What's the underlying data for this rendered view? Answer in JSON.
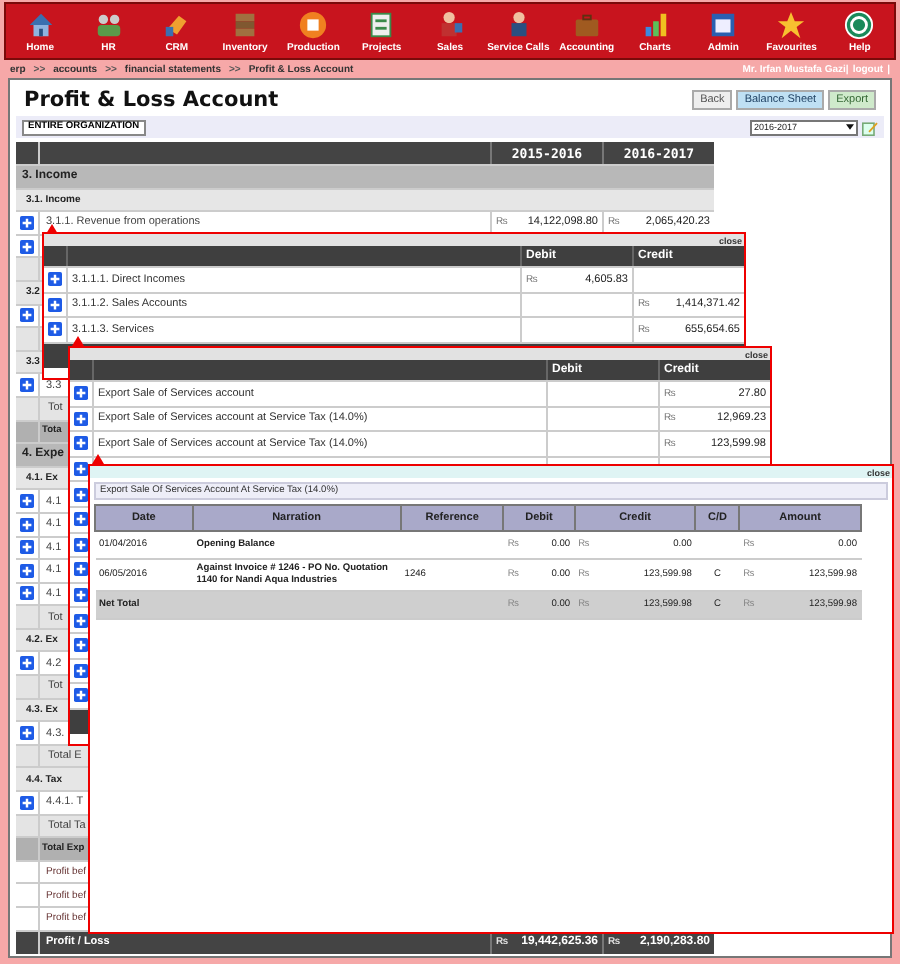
{
  "nav": [
    "Home",
    "HR",
    "CRM",
    "Inventory",
    "Production",
    "Projects",
    "Sales",
    "Service Calls",
    "Accounting",
    "Charts",
    "Admin",
    "Favourites",
    "Help"
  ],
  "breadcrumb": {
    "items": [
      "erp",
      "accounts",
      "financial statements",
      "Profit & Loss Account"
    ],
    "separator": ">>"
  },
  "user": {
    "name": "Mr. Irfan Mustafa Gazi|",
    "logout": "logout",
    "end": "|"
  },
  "page_title": "Profit & Loss Account",
  "actions": [
    "Back",
    "Balance Sheet",
    "Export"
  ],
  "scope_button": "ENTIRE ORGANIZATION",
  "year_select": {
    "value": "2016-2017"
  },
  "table": {
    "columns": [
      "2015-2016",
      "2016-2017"
    ],
    "rows": [
      {
        "kind": "section",
        "name": "3. Income"
      },
      {
        "kind": "subsection",
        "name": "3.1. Income"
      },
      {
        "kind": "item",
        "name": "3.1.1. Revenue from operations",
        "values": [
          [
            "₨",
            "14,122,098.80"
          ],
          [
            "₨",
            "2,065,420.23"
          ]
        ]
      },
      {
        "kind": "item"
      },
      {
        "kind": "total"
      },
      {
        "kind": "subsection",
        "name": "3.2"
      },
      {
        "kind": "item"
      },
      {
        "kind": "total"
      },
      {
        "kind": "subsection",
        "name": "3.3"
      },
      {
        "kind": "item",
        "name": "3.3"
      },
      {
        "kind": "total",
        "name": "Tot"
      },
      {
        "kind": "grandtotal",
        "name": "Tota"
      },
      {
        "kind": "section",
        "name": "4. Expe"
      },
      {
        "kind": "subsection",
        "name": "4.1. Ex"
      },
      {
        "kind": "item",
        "name": "4.1"
      },
      {
        "kind": "item",
        "name": "4.1"
      },
      {
        "kind": "item",
        "name": "4.1"
      },
      {
        "kind": "item",
        "name": "4.1"
      },
      {
        "kind": "item",
        "name": "4.1"
      },
      {
        "kind": "total",
        "name": "Tot"
      },
      {
        "kind": "subsection",
        "name": "4.2. Ex"
      },
      {
        "kind": "item",
        "name": "4.2"
      },
      {
        "kind": "total",
        "name": "Tot"
      },
      {
        "kind": "subsection",
        "name": "4.3. Ex"
      },
      {
        "kind": "item",
        "name": "4.3."
      },
      {
        "kind": "total",
        "name": "Total E"
      },
      {
        "kind": "subsection",
        "name": "4.4. Tax"
      },
      {
        "kind": "item",
        "name": "4.4.1. T"
      },
      {
        "kind": "total",
        "name": "Total Ta"
      },
      {
        "kind": "grandtotal",
        "name": "Total Exp"
      },
      {
        "kind": "plain",
        "name": "Profit bef"
      },
      {
        "kind": "plain",
        "name": "Profit bef"
      },
      {
        "kind": "plain",
        "name": "Profit bef"
      }
    ],
    "footer": {
      "name": "Profit / Loss",
      "values": [
        [
          "₨",
          "19,442,625.36"
        ],
        [
          "₨",
          "2,190,283.80"
        ]
      ]
    }
  },
  "popup_1": {
    "close": "close",
    "columns": [
      "Debit",
      "Credit"
    ],
    "rows": [
      {
        "name": "3.1.1.1. Direct Incomes",
        "debit": [
          "₨",
          "4,605.83"
        ]
      },
      {
        "name": "3.1.1.2. Sales Accounts",
        "credit": [
          "₨",
          "1,414,371.42"
        ]
      },
      {
        "name": "3.1.1.3. Services",
        "credit": [
          "₨",
          "655,654.65"
        ]
      }
    ]
  },
  "popup_2": {
    "close": "close",
    "columns": [
      "Debit",
      "Credit"
    ],
    "rows": [
      {
        "name": "Export Sale of Services account",
        "credit": [
          "₨",
          "27.80"
        ]
      },
      {
        "name": "Export Sale of Services account at Service Tax (14.0%)",
        "credit": [
          "₨",
          "12,969.23"
        ]
      },
      {
        "name": "Export Sale of Services account at Service Tax (14.0%)",
        "credit": [
          "₨",
          "123,599.98"
        ]
      },
      {},
      {},
      {},
      {},
      {},
      {},
      {},
      {},
      {},
      {}
    ]
  },
  "popup_3": {
    "close": "close",
    "title": "Export Sale Of Services Account At Service Tax (14.0%)",
    "columns": [
      "Date",
      "Narration",
      "Reference",
      "Debit",
      "Credit",
      "C/D",
      "Amount"
    ],
    "rows": [
      {
        "date": "01/04/2016",
        "narration": "Opening Balance",
        "debit": [
          "₨",
          "0.00"
        ],
        "credit": [
          "₨",
          "0.00"
        ],
        "amount": [
          "₨",
          "0.00"
        ]
      },
      {
        "date": "06/05/2016",
        "narration": "Against Invoice # 1246 - PO No. Quotation 1140 for Nandi Aqua Industries",
        "reference": "1246",
        "debit": [
          "₨",
          "0.00"
        ],
        "credit": [
          "₨",
          "123,599.98"
        ],
        "cd": "C",
        "amount": [
          "₨",
          "123,599.98"
        ]
      }
    ],
    "total": {
      "label": "Net Total",
      "debit": [
        "₨",
        "0.00"
      ],
      "credit": [
        "₨",
        "123,599.98"
      ],
      "cd": "C",
      "amount": [
        "₨",
        "123,599.98"
      ]
    }
  }
}
